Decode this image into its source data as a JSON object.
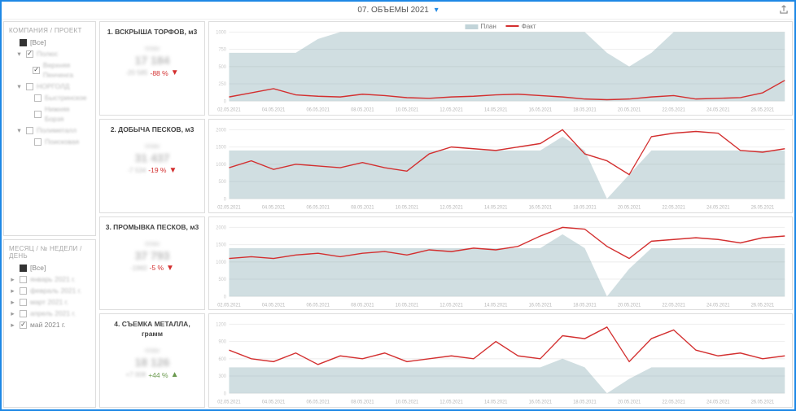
{
  "header": {
    "title": "07. ОБЪЕМЫ 2021",
    "filter_icon": "▾"
  },
  "legend": {
    "plan": "План",
    "fact": "Факт"
  },
  "sidebar": {
    "companies": {
      "title": "КОМПАНИЯ / ПРОЕКТ",
      "items": [
        {
          "label": "[Все]",
          "checked": "solid",
          "indent": 0,
          "blur": false
        },
        {
          "label": "Полюс",
          "checked": true,
          "indent": 1,
          "expander": "▾",
          "blur": true
        },
        {
          "label": "Верхняя Пенченга",
          "checked": true,
          "indent": 2,
          "blur": true
        },
        {
          "label": "НОРГОЛД",
          "checked": false,
          "indent": 1,
          "expander": "▾",
          "blur": true
        },
        {
          "label": "Быстринское",
          "checked": false,
          "indent": 2,
          "blur": true
        },
        {
          "label": "Нижняя Борзя",
          "checked": false,
          "indent": 2,
          "blur": true
        },
        {
          "label": "Полиметалл",
          "checked": false,
          "indent": 1,
          "expander": "▾",
          "blur": true
        },
        {
          "label": "Поисковая",
          "checked": false,
          "indent": 2,
          "blur": true
        }
      ]
    },
    "dates": {
      "title": "МЕСЯЦ / № НЕДЕЛИ / ДЕНЬ",
      "items": [
        {
          "label": "[Все]",
          "checked": "solid",
          "indent": 0,
          "blur": false
        },
        {
          "label": "январь 2021 г.",
          "checked": false,
          "indent": 0,
          "expander": "▸",
          "blur": true
        },
        {
          "label": "февраль 2021 г.",
          "checked": false,
          "indent": 0,
          "expander": "▸",
          "blur": true
        },
        {
          "label": "март 2021 г.",
          "checked": false,
          "indent": 0,
          "expander": "▸",
          "blur": true
        },
        {
          "label": "апрель 2021 г.",
          "checked": false,
          "indent": 0,
          "expander": "▸",
          "blur": true
        },
        {
          "label": "май 2021 г.",
          "checked": true,
          "indent": 0,
          "expander": "▸",
          "blur": false
        }
      ]
    }
  },
  "kpis": [
    {
      "title": "1. ВСКРЫША ТОРФОВ, м3",
      "value": "17 184",
      "sub": "-20 585",
      "delta": "-88 %",
      "dir": "down",
      "color": "red"
    },
    {
      "title": "2. ДОБЫЧА ПЕСКОВ, м3",
      "value": "31 437",
      "sub": "-7 534",
      "delta": "-19 %",
      "dir": "down",
      "color": "red"
    },
    {
      "title": "3. ПРОМЫВКА ПЕСКОВ, м3",
      "value": "37 793",
      "sub": "-1960",
      "delta": "-5 %",
      "dir": "down",
      "color": "red"
    },
    {
      "title": "4. СЪЕМКА МЕТАЛЛА, грамм",
      "value": "18 126",
      "sub": "+7 008",
      "delta": "+44 %",
      "dir": "up",
      "color": "green"
    }
  ],
  "x_labels": [
    "02.05.2021",
    "04.05.2021",
    "06.05.2021",
    "08.05.2021",
    "10.05.2021",
    "12.05.2021",
    "14.05.2021",
    "16.05.2021",
    "18.05.2021",
    "20.05.2021",
    "22.05.2021",
    "24.05.2021",
    "26.05.2021"
  ],
  "chart_data": [
    {
      "type": "combo",
      "title": "1. ВСКРЫША ТОРФОВ, м3",
      "x": [
        "02.05",
        "03.05",
        "04.05",
        "05.05",
        "06.05",
        "07.05",
        "08.05",
        "09.05",
        "10.05",
        "11.05",
        "12.05",
        "13.05",
        "14.05",
        "15.05",
        "16.05",
        "17.05",
        "18.05",
        "19.05",
        "20.05",
        "21.05",
        "22.05",
        "23.05",
        "24.05",
        "25.05",
        "26.05",
        "27.05"
      ],
      "series": [
        {
          "name": "План",
          "kind": "area",
          "values": [
            700,
            700,
            700,
            700,
            900,
            1000,
            1000,
            1000,
            1000,
            1000,
            1000,
            1000,
            1000,
            1000,
            1000,
            1000,
            1000,
            700,
            500,
            700,
            1000,
            1000,
            1000,
            1000,
            1000,
            1000
          ]
        },
        {
          "name": "Факт",
          "kind": "line",
          "values": [
            60,
            120,
            180,
            90,
            70,
            60,
            100,
            80,
            50,
            40,
            60,
            70,
            90,
            100,
            80,
            60,
            30,
            20,
            30,
            60,
            80,
            30,
            40,
            50,
            120,
            300
          ]
        }
      ],
      "ylim": [
        0,
        1000
      ],
      "yticks": [
        0,
        250,
        500,
        750,
        1000
      ]
    },
    {
      "type": "combo",
      "title": "2. ДОБЫЧА ПЕСКОВ, м3",
      "x": [
        "02.05",
        "03.05",
        "04.05",
        "05.05",
        "06.05",
        "07.05",
        "08.05",
        "09.05",
        "10.05",
        "11.05",
        "12.05",
        "13.05",
        "14.05",
        "15.05",
        "16.05",
        "17.05",
        "18.05",
        "19.05",
        "20.05",
        "21.05",
        "22.05",
        "23.05",
        "24.05",
        "25.05",
        "26.05",
        "27.05"
      ],
      "series": [
        {
          "name": "План",
          "kind": "area",
          "values": [
            1400,
            1400,
            1400,
            1400,
            1400,
            1400,
            1400,
            1400,
            1400,
            1400,
            1400,
            1400,
            1400,
            1400,
            1400,
            1800,
            1400,
            0,
            700,
            1400,
            1400,
            1400,
            1400,
            1400,
            1400,
            1400
          ]
        },
        {
          "name": "Факт",
          "kind": "line",
          "values": [
            900,
            1100,
            850,
            1000,
            950,
            900,
            1050,
            900,
            800,
            1300,
            1500,
            1450,
            1400,
            1500,
            1600,
            2000,
            1300,
            1100,
            700,
            1800,
            1900,
            1950,
            1900,
            1400,
            1350,
            1450
          ]
        }
      ],
      "ylim": [
        0,
        2000
      ],
      "yticks": [
        0,
        500,
        1000,
        1500,
        2000
      ]
    },
    {
      "type": "combo",
      "title": "3. ПРОМЫВКА ПЕСКОВ, м3",
      "x": [
        "02.05",
        "03.05",
        "04.05",
        "05.05",
        "06.05",
        "07.05",
        "08.05",
        "09.05",
        "10.05",
        "11.05",
        "12.05",
        "13.05",
        "14.05",
        "15.05",
        "16.05",
        "17.05",
        "18.05",
        "19.05",
        "20.05",
        "21.05",
        "22.05",
        "23.05",
        "24.05",
        "25.05",
        "26.05",
        "27.05"
      ],
      "series": [
        {
          "name": "План",
          "kind": "area",
          "values": [
            1400,
            1400,
            1400,
            1400,
            1400,
            1400,
            1400,
            1400,
            1400,
            1400,
            1400,
            1400,
            1400,
            1400,
            1400,
            1800,
            1400,
            0,
            800,
            1400,
            1400,
            1400,
            1400,
            1400,
            1400,
            1400
          ]
        },
        {
          "name": "Факт",
          "kind": "line",
          "values": [
            1100,
            1150,
            1100,
            1200,
            1250,
            1150,
            1250,
            1300,
            1200,
            1350,
            1300,
            1400,
            1350,
            1450,
            1750,
            2000,
            1950,
            1450,
            1100,
            1600,
            1650,
            1700,
            1650,
            1550,
            1700,
            1750
          ]
        }
      ],
      "ylim": [
        0,
        2000
      ],
      "yticks": [
        0,
        500,
        1000,
        1500,
        2000
      ]
    },
    {
      "type": "combo",
      "title": "4. СЪЕМКА МЕТАЛЛА, грамм",
      "x": [
        "02.05",
        "03.05",
        "04.05",
        "05.05",
        "06.05",
        "07.05",
        "08.05",
        "09.05",
        "10.05",
        "11.05",
        "12.05",
        "13.05",
        "14.05",
        "15.05",
        "16.05",
        "17.05",
        "18.05",
        "19.05",
        "20.05",
        "21.05",
        "22.05",
        "23.05",
        "24.05",
        "25.05",
        "26.05",
        "27.05"
      ],
      "series": [
        {
          "name": "План",
          "kind": "area",
          "values": [
            450,
            450,
            450,
            450,
            450,
            450,
            450,
            450,
            450,
            450,
            450,
            450,
            450,
            450,
            450,
            600,
            450,
            0,
            250,
            450,
            450,
            450,
            450,
            450,
            450,
            450
          ]
        },
        {
          "name": "Факт",
          "kind": "line",
          "values": [
            750,
            600,
            550,
            700,
            500,
            650,
            600,
            700,
            550,
            600,
            650,
            600,
            900,
            650,
            600,
            1000,
            950,
            1150,
            550,
            950,
            1100,
            750,
            650,
            700,
            600,
            650
          ]
        }
      ],
      "ylim": [
        0,
        1200
      ],
      "yticks": [
        0,
        300,
        600,
        900,
        1200
      ]
    }
  ]
}
